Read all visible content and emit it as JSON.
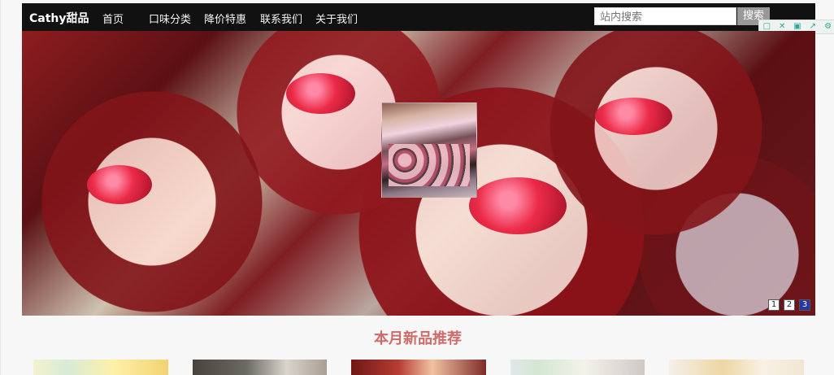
{
  "brand": "Cathy甜品",
  "nav": {
    "items": [
      "首页",
      "口味分类",
      "降价特惠",
      "联系我们",
      "关于我们"
    ]
  },
  "search": {
    "placeholder": "站内搜索",
    "button": "搜索"
  },
  "hero": {
    "pagination": [
      "1",
      "2",
      "3"
    ],
    "active_page": 3
  },
  "section": {
    "title": "本月新品推荐"
  },
  "colors": {
    "nav_bg": "#111111",
    "section_title": "#cf6b6b",
    "pager_active": "#2635a3"
  }
}
